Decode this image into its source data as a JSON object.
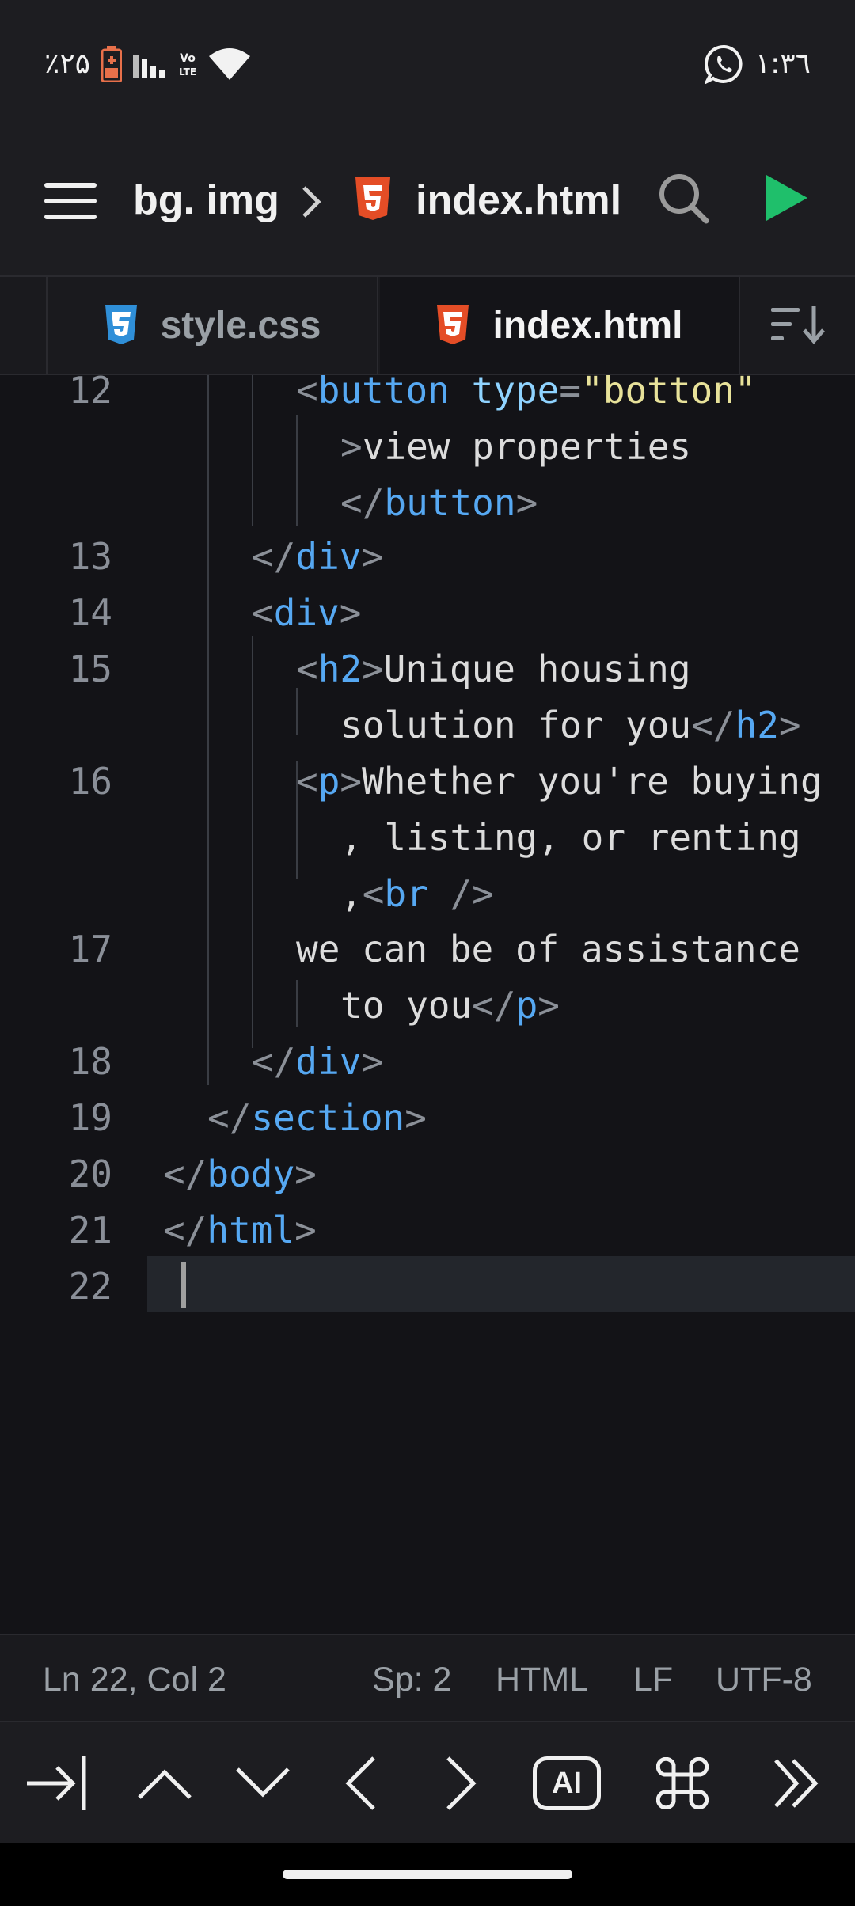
{
  "status_bar": {
    "battery_text": "٪۲۵",
    "time": "۱:۳٦",
    "colors": {
      "battery": "#e8704a"
    },
    "icons": [
      "battery-icon",
      "signal-icon",
      "volte-icon",
      "wifi-icon",
      "whatsapp-icon"
    ]
  },
  "toolbar": {
    "project": "bg. img",
    "file": "index.html",
    "icons": [
      "menu-icon",
      "chevron-right-icon",
      "html5-icon",
      "search-icon",
      "play-icon"
    ],
    "colors": {
      "html": "#e44d26",
      "run": "#1fbf6b"
    }
  },
  "tabs": [
    {
      "label": "style.css",
      "icon": "css3-icon",
      "color": "#2f8fd8"
    },
    {
      "label": "index.html",
      "icon": "html5-icon",
      "color": "#e44d26",
      "active": true
    }
  ],
  "editor": {
    "line_numbers": [
      "12",
      "13",
      "14",
      "15",
      "16",
      "17",
      "18",
      "19",
      "20",
      "21",
      "22"
    ],
    "lines": {
      "l12a": {
        "open": "<",
        "tag": "button",
        "sp": " ",
        "attr": "type",
        "eq": "=",
        "str": "\"botton\""
      },
      "l12b": {
        "close": ">",
        "text": "view properties"
      },
      "l12c": {
        "open": "</",
        "tag": "button",
        "close": ">"
      },
      "l13": {
        "open": "</",
        "tag": "div",
        "close": ">"
      },
      "l14": {
        "open": "<",
        "tag": "div",
        "close": ">"
      },
      "l15a": {
        "open": "<",
        "tag": "h2",
        "close": ">",
        "text": "Unique housing"
      },
      "l15b": {
        "text": "solution for you",
        "open": "</",
        "tag": "h2",
        "close": ">"
      },
      "l16a": {
        "open": "<",
        "tag": "p",
        "close": ">",
        "text": "Whether you're buying"
      },
      "l16b": {
        "text": ", listing, or renting"
      },
      "l16c": {
        "text": ",",
        "open": "<",
        "tag": "br",
        "close": " />"
      },
      "l17a": {
        "text": "we can be of assistance"
      },
      "l17b": {
        "text": "to you",
        "open": "</",
        "tag": "p",
        "close": ">"
      },
      "l18": {
        "open": "</",
        "tag": "div",
        "close": ">"
      },
      "l19": {
        "open": "</",
        "tag": "section",
        "close": ">"
      },
      "l20": {
        "open": "</",
        "tag": "body",
        "close": ">"
      },
      "l21": {
        "open": "</",
        "tag": "html",
        "close": ">"
      }
    }
  },
  "editor_status": {
    "position": "Ln 22, Col 2",
    "spaces": "Sp: 2",
    "language": "HTML",
    "line_ending": "LF",
    "encoding": "UTF-8"
  },
  "shortcuts": {
    "ai_label": "AI",
    "icons": [
      "tab-indent-icon",
      "arrow-up-icon",
      "arrow-down-icon",
      "arrow-left-icon",
      "arrow-right-icon",
      "ai-icon",
      "command-icon",
      "more-icon"
    ]
  }
}
